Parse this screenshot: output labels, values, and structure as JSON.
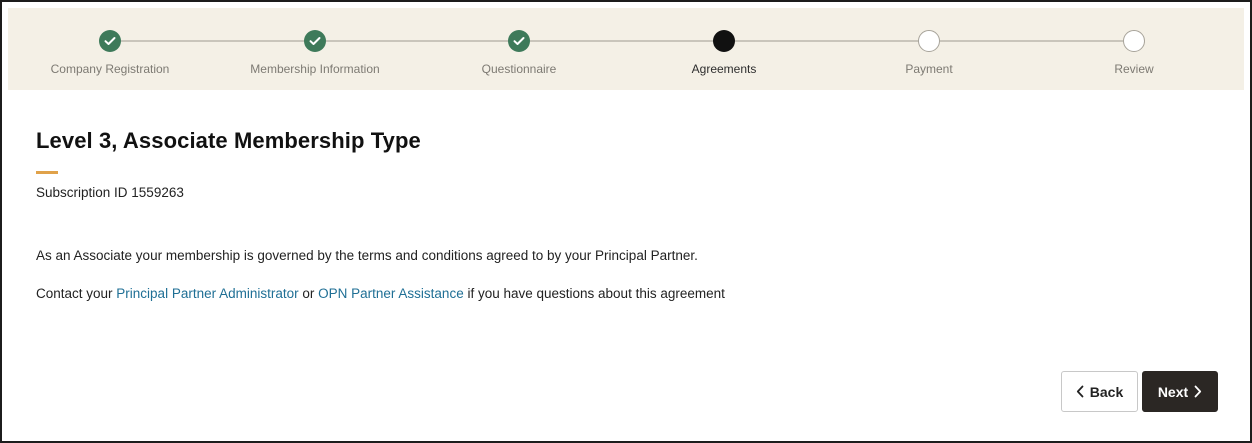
{
  "stepper": {
    "steps": [
      {
        "label": "Company Registration",
        "state": "done"
      },
      {
        "label": "Membership Information",
        "state": "done"
      },
      {
        "label": "Questionnaire",
        "state": "done"
      },
      {
        "label": "Agreements",
        "state": "current"
      },
      {
        "label": "Payment",
        "state": "todo"
      },
      {
        "label": "Review",
        "state": "todo"
      }
    ]
  },
  "main": {
    "title": "Level 3, Associate Membership Type",
    "subscription_id": "Subscription ID 1559263",
    "paragraph1": "As an Associate your membership is governed by the terms and conditions agreed to by your Principal Partner.",
    "paragraph2": {
      "prefix": "Contact your ",
      "link1": "Principal Partner Administrator",
      "middle": " or ",
      "link2": "OPN Partner Assistance",
      "suffix": " if you have questions about this agreement"
    }
  },
  "buttons": {
    "back": "Back",
    "next": "Next"
  },
  "colors": {
    "step_done": "#3e7a5a",
    "step_current": "#111111",
    "accent": "#e0a24a",
    "link": "#1f6f95",
    "stepper_bg": "#f4f0e6",
    "next_button_bg": "#2b2724"
  },
  "icons": {
    "step_done": "check-icon",
    "back": "chevron-left-icon",
    "next": "chevron-right-icon"
  }
}
